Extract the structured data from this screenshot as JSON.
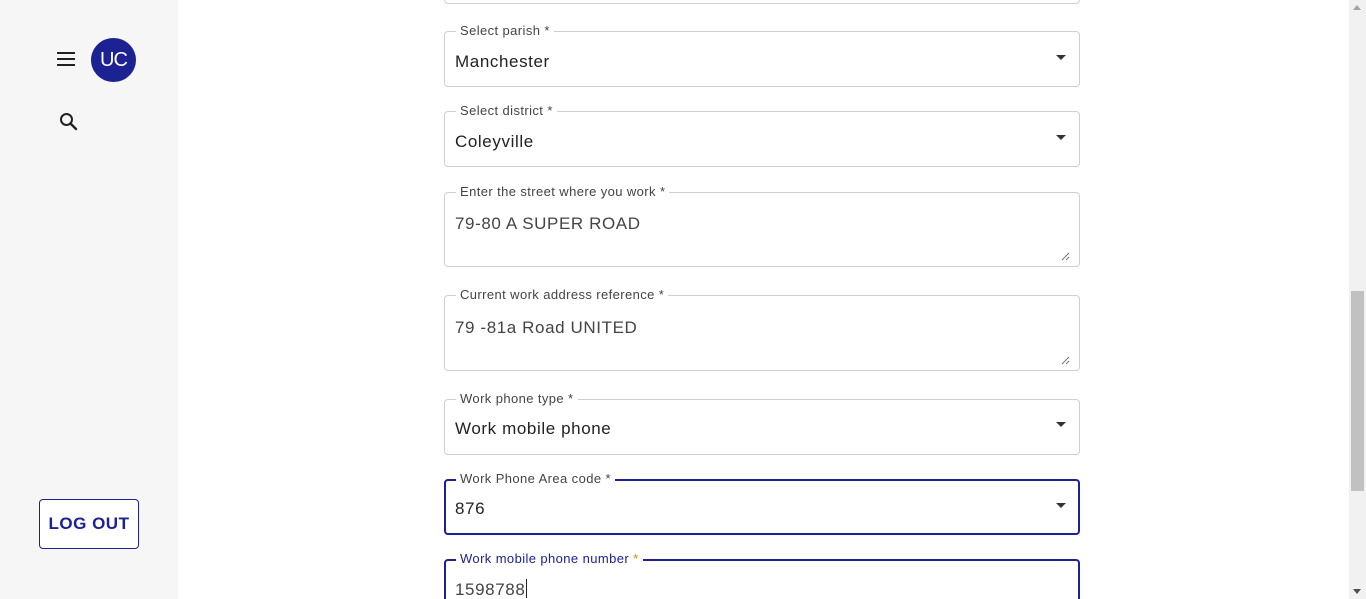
{
  "sidebar": {
    "avatar_initials": "UC",
    "menu_icon": "hamburger-menu-icon",
    "search_icon": "search-icon",
    "logout_label": "LOG OUT"
  },
  "form": {
    "parish": {
      "label": "Select parish *",
      "value": "Manchester"
    },
    "district": {
      "label": "Select district *",
      "value": "Coleyville"
    },
    "street": {
      "label": "Enter the street where you work *",
      "value": "79-80 A SUPER ROAD"
    },
    "reference": {
      "label": "Current work address reference *",
      "value": "79 -81a Road UNITED"
    },
    "phone_type": {
      "label": "Work phone type *",
      "value": "Work mobile phone"
    },
    "area_code": {
      "label": "Work Phone Area code *",
      "value": "876"
    },
    "mobile_number": {
      "label_text": "Work mobile phone number ",
      "label_required": "*",
      "value": "1598788"
    }
  },
  "colors": {
    "accent": "#1c2292",
    "required_marker": "#e08a00",
    "sidebar_bg": "#f6f6f6"
  }
}
